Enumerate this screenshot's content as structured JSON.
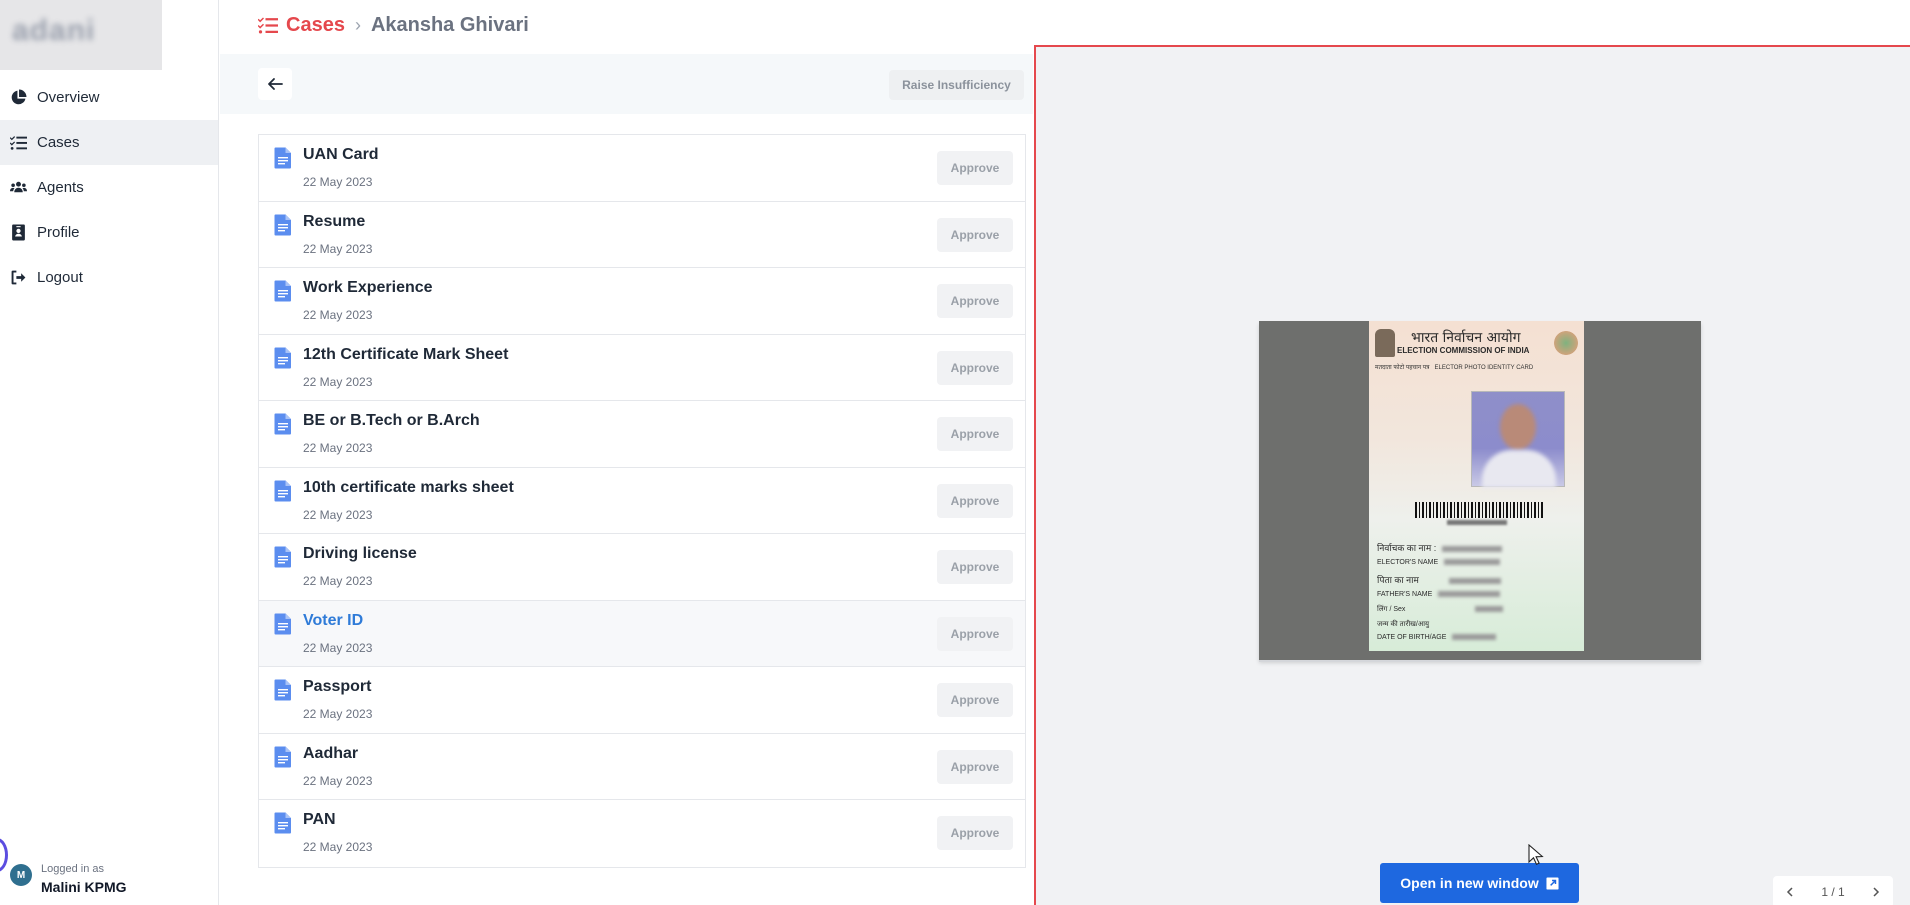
{
  "brand": {
    "logo_text": "adani"
  },
  "sidebar": {
    "items": [
      {
        "label": "Overview",
        "icon": "chart-pie-icon",
        "active": false
      },
      {
        "label": "Cases",
        "icon": "list-check-icon",
        "active": true
      },
      {
        "label": "Agents",
        "icon": "users-icon",
        "active": false
      },
      {
        "label": "Profile",
        "icon": "id-badge-icon",
        "active": false
      },
      {
        "label": "Logout",
        "icon": "logout-icon",
        "active": false
      }
    ],
    "user": {
      "avatar_initial": "M",
      "logged_in_label": "Logged in as",
      "name": "Malini KPMG"
    }
  },
  "header": {
    "breadcrumb_root": "Cases",
    "breadcrumb_current": "Akansha Ghivari"
  },
  "toolbar": {
    "raise_label": "Raise Insufficiency"
  },
  "documents": [
    {
      "title": "UAN Card",
      "date": "22 May 2023",
      "action": "Approve"
    },
    {
      "title": "Resume",
      "date": "22 May 2023",
      "action": "Approve"
    },
    {
      "title": "Work Experience",
      "date": "22 May 2023",
      "action": "Approve"
    },
    {
      "title": "12th Certificate Mark Sheet",
      "date": "22 May 2023",
      "action": "Approve"
    },
    {
      "title": "BE or B.Tech or B.Arch",
      "date": "22 May 2023",
      "action": "Approve"
    },
    {
      "title": "10th certificate marks sheet",
      "date": "22 May 2023",
      "action": "Approve"
    },
    {
      "title": "Driving license",
      "date": "22 May 2023",
      "action": "Approve"
    },
    {
      "title": "Voter ID",
      "date": "22 May 2023",
      "action": "Approve"
    },
    {
      "title": "Passport",
      "date": "22 May 2023",
      "action": "Approve"
    },
    {
      "title": "Aadhar",
      "date": "22 May 2023",
      "action": "Approve"
    },
    {
      "title": "PAN",
      "date": "22 May 2023",
      "action": "Approve"
    }
  ],
  "preview": {
    "card": {
      "hindi_title": "भारत निर्वाचन आयोग",
      "english_title": "ELECTION COMMISSION OF INDIA",
      "subtitle_hindi": "मतदाता फोटो पहचान पत्र",
      "subtitle_english": "ELECTOR PHOTO IDENTITY CARD",
      "elector_name_hindi": "निर्वाचक का नाम :",
      "elector_name_label": "ELECTOR'S NAME",
      "father_name_hindi": "पिता का नाम",
      "father_name_label": "FATHER'S NAME",
      "sex_label": "लिंग / Sex",
      "dob_hindi": "जन्म की तारीख/आयु",
      "dob_label": "DATE OF BIRTH/AGE"
    },
    "open_button": "Open in new window",
    "pager": "1 / 1"
  },
  "colors": {
    "accent_red": "#e5484d",
    "primary_blue": "#1e68e0",
    "selected_blue": "#2f7bd8"
  }
}
